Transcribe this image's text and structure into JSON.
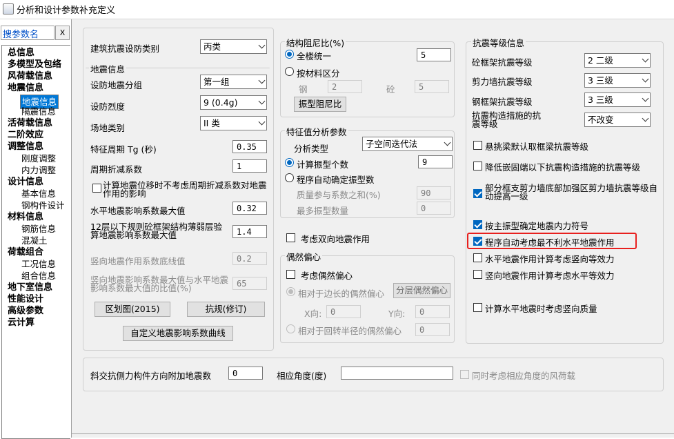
{
  "window": {
    "title": "分析和设计参数补充定义"
  },
  "search": {
    "label": "搜参数名",
    "clear": "X"
  },
  "tree": {
    "items": [
      {
        "label": "总信息"
      },
      {
        "label": "多模型及包络"
      },
      {
        "label": "风荷载信息"
      },
      {
        "label": "地震信息"
      },
      {
        "label": "地震信息"
      },
      {
        "label": "隔震信息"
      },
      {
        "label": "活荷载信息"
      },
      {
        "label": "二阶效应"
      },
      {
        "label": "调整信息"
      },
      {
        "label": "刚度调整"
      },
      {
        "label": "内力调整"
      },
      {
        "label": "设计信息"
      },
      {
        "label": "基本信息"
      },
      {
        "label": "钢构件设计"
      },
      {
        "label": "材料信息"
      },
      {
        "label": "钢筋信息"
      },
      {
        "label": "混凝土"
      },
      {
        "label": "荷载组合"
      },
      {
        "label": "工况信息"
      },
      {
        "label": "组合信息"
      },
      {
        "label": "地下室信息"
      },
      {
        "label": "性能设计"
      },
      {
        "label": "高级参数"
      },
      {
        "label": "云计算"
      }
    ]
  },
  "left_panel": {
    "fortify_category_label": "建筑抗震设防类别",
    "fortify_category_value": "丙类",
    "group_title": "地震信息",
    "design_group_label": "设防地震分组",
    "design_group_value": "第一组",
    "intensity_label": "设防烈度",
    "intensity_value": "9 (0.4g)",
    "site_label": "场地类别",
    "site_value": "II 类",
    "tg_label": "特征周期 Tg (秒)",
    "tg_value": "0.35",
    "period_reduce_label": "周期折减系数",
    "period_reduce_value": "1",
    "ignore_reduce_label": "计算地震位移时不考虑周期折减系数对地震作用的影响",
    "alpha_max_label": "水平地震影响系数最大值",
    "alpha_max_value": "0.32",
    "weak_layer_label": "12层以下规则砼框架结构薄弱层验算地震影响系数最大值",
    "weak_layer_value": "1.4",
    "vertical_floor_label": "竖向地震作用系数底线值",
    "vertical_floor_value": "0.2",
    "vertical_ratio_label": "竖向地震影响系数最大值与水平地震影响系数最大值的比值(%)",
    "vertical_ratio_value": "65",
    "zone_btn": "区划图(2015)",
    "code_btn": "抗规(修订)",
    "custom_curve_btn": "自定义地震影响系数曲线"
  },
  "damping": {
    "title": "结构阻尼比(%)",
    "whole_label": "全楼统一",
    "whole_value": "5",
    "by_material_label": "按材料区分",
    "steel_label": "钢",
    "steel_value": "2",
    "concrete_label": "砼",
    "concrete_value": "5",
    "mode_damping_btn": "振型阻尼比"
  },
  "eigen": {
    "title": "特征值分析参数",
    "type_label": "分析类型",
    "type_value": "子空间迭代法",
    "mode_count_label": "计算振型个数",
    "mode_count_value": "9",
    "auto_label": "程序自动确定振型数",
    "mass_sum_label": "质量参与系数之和(%)",
    "mass_sum_value": "90",
    "max_modes_label": "最多振型数量",
    "max_modes_value": "0"
  },
  "bidir": {
    "label": "考虑双向地震作用"
  },
  "ecc": {
    "title": "偶然偏心",
    "consider_label": "考虑偶然偏心",
    "edge_label": "相对于边长的偶然偏心",
    "layer_btn": "分层偶然偏心",
    "x_label": "X向:",
    "x_value": "0",
    "y_label": "Y向:",
    "y_value": "0",
    "radius_label": "相对于回转半径的偶然偏心",
    "radius_value": "0"
  },
  "grade": {
    "title": "抗震等级信息",
    "rc_frame_label": "砼框架抗震等级",
    "rc_frame_value": "2 二级",
    "shear_wall_label": "剪力墙抗震等级",
    "shear_wall_value": "3 三级",
    "steel_frame_label": "钢框架抗震等级",
    "steel_frame_value": "3 三级",
    "detail_label": "抗震构造措施的抗震等级",
    "detail_value": "不改变",
    "cantilever_label": "悬挑梁默认取框梁抗震等级",
    "embed_label": "降低嵌固端以下抗震构造措施的抗震等级",
    "partial_label": "部分框支剪力墙底部加强区剪力墙抗震等级自动提高一级",
    "main_mode_label": "按主振型确定地震内力符号",
    "worst_dir_label": "程序自动考虑最不利水平地震作用",
    "h_equiv_label": "水平地震作用计算考虑竖向等效力",
    "v_equiv_label": "竖向地震作用计算考虑水平等效力",
    "vertical_mass_label": "计算水平地震时考虑竖向质量"
  },
  "bottom": {
    "oblique_label": "斜交抗侧力构件方向附加地震数",
    "oblique_value": "0",
    "angle_label": "相应角度(度)",
    "angle_value": "",
    "wind_label": "同时考虑相应角度的风荷载"
  }
}
